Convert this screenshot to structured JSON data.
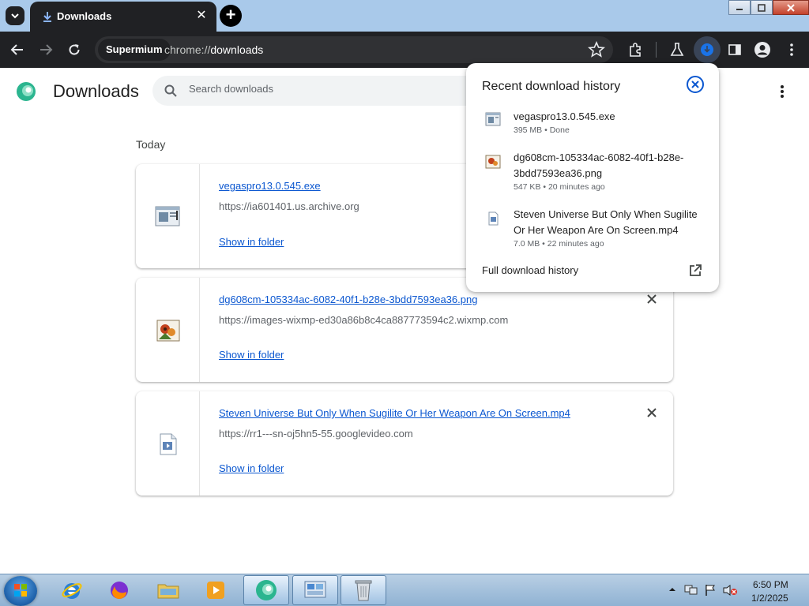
{
  "browser": {
    "tab_title": "Downloads",
    "site_chip": "Supermium",
    "url_scheme": "chrome://",
    "url_path": "downloads"
  },
  "page": {
    "title": "Downloads",
    "search_placeholder": "Search downloads",
    "section_label": "Today",
    "show_in_folder_label": "Show in folder"
  },
  "downloads": [
    {
      "name": "vegaspro13.0.545.exe",
      "url": "https://ia601401.us.archive.org",
      "icon": "exe-file-icon"
    },
    {
      "name": "dg608cm-105334ac-6082-40f1-b28e-3bdd7593ea36.png",
      "url": "https://images-wixmp-ed30a86b8c4ca887773594c2.wixmp.com",
      "icon": "image-file-icon"
    },
    {
      "name": "Steven Universe But Only When Sugilite Or Her Weapon Are On Screen.mp4",
      "url": "https://rr1---sn-oj5hn5-55.googlevideo.com",
      "icon": "video-file-icon"
    }
  ],
  "bubble": {
    "title": "Recent download history",
    "items": [
      {
        "name": "vegaspro13.0.545.exe",
        "meta": "395 MB • Done"
      },
      {
        "name": "dg608cm-105334ac-6082-40f1-b28e-3bdd7593ea36.png",
        "meta": "547 KB • 20 minutes ago"
      },
      {
        "name": "Steven Universe But Only When Sugilite Or Her Weapon Are On Screen.mp4",
        "meta": "7.0 MB • 22 minutes ago"
      }
    ],
    "full_history_label": "Full download history"
  },
  "taskbar": {
    "time": "6:50 PM",
    "date": "1/2/2025"
  },
  "colors": {
    "link": "#0b57d0",
    "toolbar": "#202124",
    "accent": "#1a73e8"
  }
}
